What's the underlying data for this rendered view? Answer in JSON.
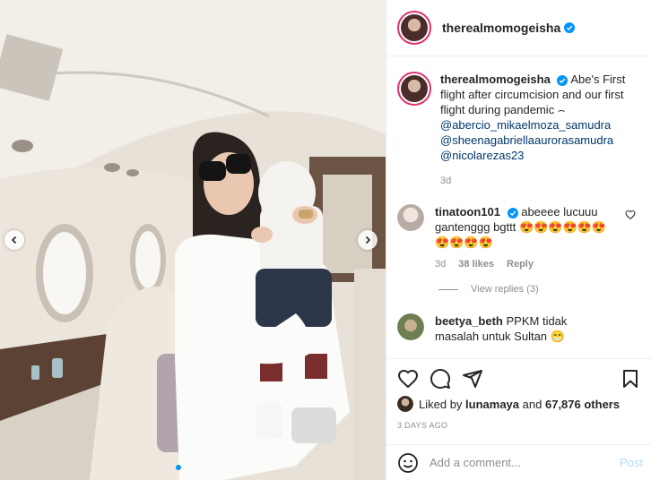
{
  "post": {
    "username": "therealmomogeisha",
    "caption": {
      "username": "therealmomogeisha",
      "text": "Abe's First flight after circumcision and our first flight during pandemic ⌢",
      "mentions": [
        "@abercio_mikaelmoza_samudra",
        "@sheenagabriellaaurorasamudra",
        "@nicolarezas23"
      ],
      "age": "3d"
    },
    "comments": [
      {
        "username": "tinatoon101",
        "text": "abeeee lucuuu gantenggg bgttt 😍😍😍😍😍😍😍😍😍😍",
        "age": "3d",
        "likes": "38 likes",
        "reply_label": "Reply",
        "view_replies": "View replies (3)"
      },
      {
        "username": "beetya_beth",
        "text": "PPKM tidak masalah untuk Sultan 😁"
      }
    ],
    "liked_by": {
      "prefix": "Liked by",
      "user": "lunamaya",
      "middle": "and",
      "count": "67,876 others"
    },
    "timestamp": "3 DAYS AGO",
    "add_comment_placeholder": "Add a comment...",
    "post_button": "Post",
    "carousel": {
      "slides": 4,
      "active_index": 0
    },
    "colors": {
      "verified": "#0095f6",
      "mention": "#00376b",
      "muted": "#8e8e8e",
      "post_disabled": "#b2dffc",
      "story_ring": "#e1306c"
    }
  }
}
